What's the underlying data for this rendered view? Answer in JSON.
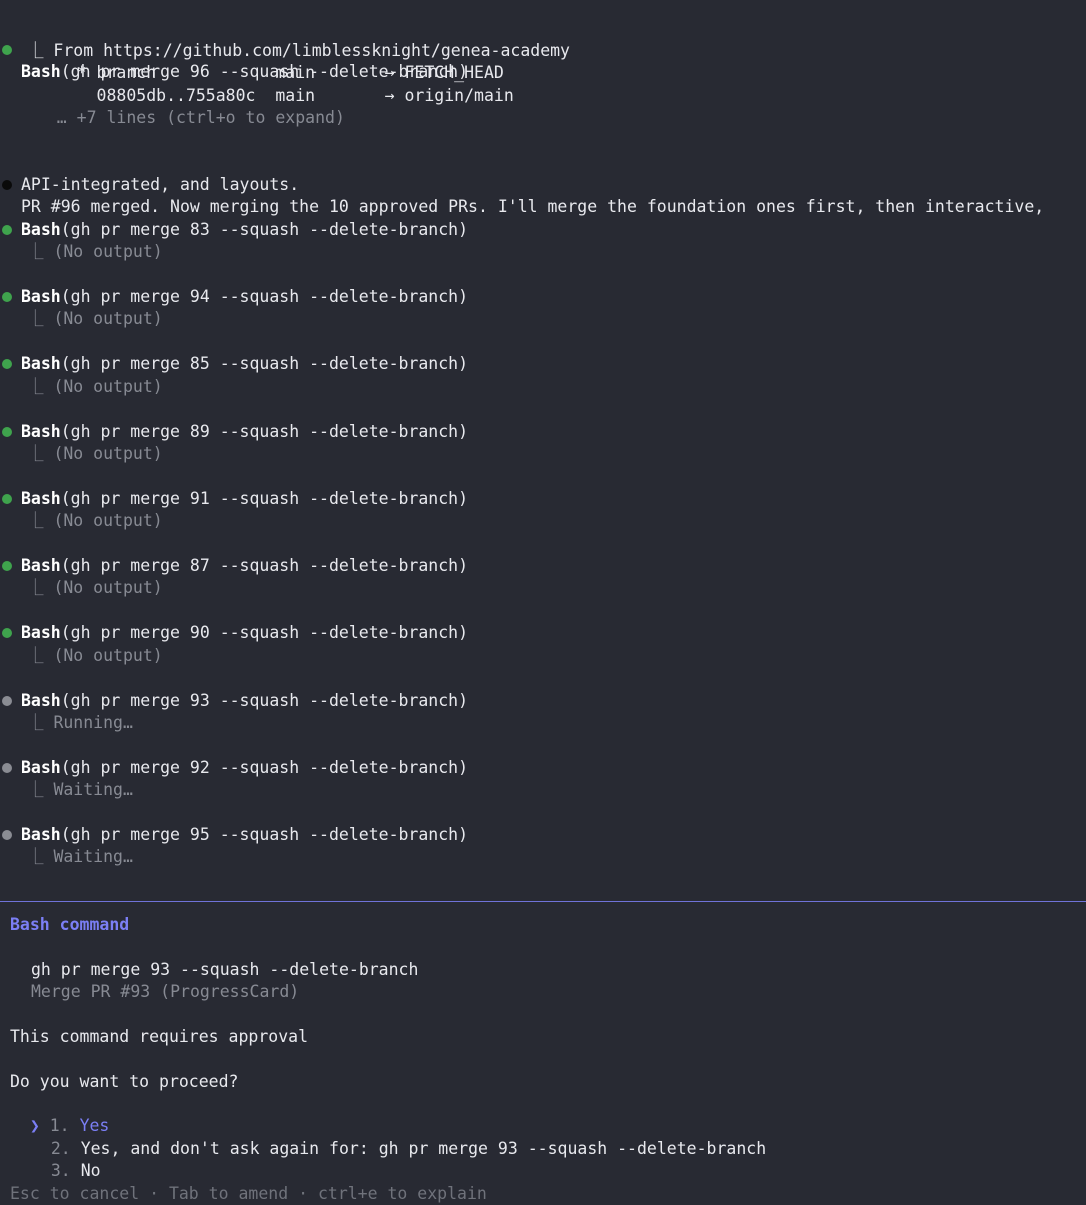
{
  "log": {
    "first": {
      "tool": "Bash",
      "args": "(gh pr merge 96 --squash --delete-branch)",
      "out1": "⎿ From https://github.com/limblessknight/genea-academy",
      "out2": "     * branch            main       → FETCH_HEAD",
      "out3": "       08805db..755a80c  main       → origin/main",
      "expand": "   … +7 lines (ctrl+o to expand)"
    },
    "message_line1": "PR #96 merged. Now merging the 10 approved PRs. I'll merge the foundation ones first, then interactive,",
    "message_line2": "API-integrated, and layouts.",
    "entries": [
      {
        "tool": "Bash",
        "args": "(gh pr merge 83 --squash --delete-branch)",
        "output": "(No output)",
        "status": "done"
      },
      {
        "tool": "Bash",
        "args": "(gh pr merge 94 --squash --delete-branch)",
        "output": "(No output)",
        "status": "done"
      },
      {
        "tool": "Bash",
        "args": "(gh pr merge 85 --squash --delete-branch)",
        "output": "(No output)",
        "status": "done"
      },
      {
        "tool": "Bash",
        "args": "(gh pr merge 89 --squash --delete-branch)",
        "output": "(No output)",
        "status": "done"
      },
      {
        "tool": "Bash",
        "args": "(gh pr merge 91 --squash --delete-branch)",
        "output": "(No output)",
        "status": "done"
      },
      {
        "tool": "Bash",
        "args": "(gh pr merge 87 --squash --delete-branch)",
        "output": "(No output)",
        "status": "done"
      },
      {
        "tool": "Bash",
        "args": "(gh pr merge 90 --squash --delete-branch)",
        "output": "(No output)",
        "status": "done"
      },
      {
        "tool": "Bash",
        "args": "(gh pr merge 93 --squash --delete-branch)",
        "output": "Running…",
        "status": "running"
      },
      {
        "tool": "Bash",
        "args": "(gh pr merge 92 --squash --delete-branch)",
        "output": "Waiting…",
        "status": "waiting"
      },
      {
        "tool": "Bash",
        "args": "(gh pr merge 95 --squash --delete-branch)",
        "output": "Waiting…",
        "status": "waiting"
      }
    ],
    "elbow": "⎿ "
  },
  "prompt": {
    "title": "Bash command",
    "command": "gh pr merge 93 --squash --delete-branch",
    "description": "Merge PR #93 (ProgressCard)",
    "approval_text": "This command requires approval",
    "question": "Do you want to proceed?",
    "pointer": "❯",
    "options": [
      {
        "num": "1.",
        "label": "Yes"
      },
      {
        "num": "2.",
        "label": "Yes, and don't ask again for: gh pr merge 93 --squash --delete-branch"
      },
      {
        "num": "3.",
        "label": "No"
      }
    ],
    "footer": "Esc to cancel · Tab to amend · ctrl+e to explain"
  },
  "colors": {
    "background": "#282a33",
    "done_dot": "#3fa34d",
    "pending_dot": "#8a8c93",
    "accent": "#7b7ff5"
  }
}
